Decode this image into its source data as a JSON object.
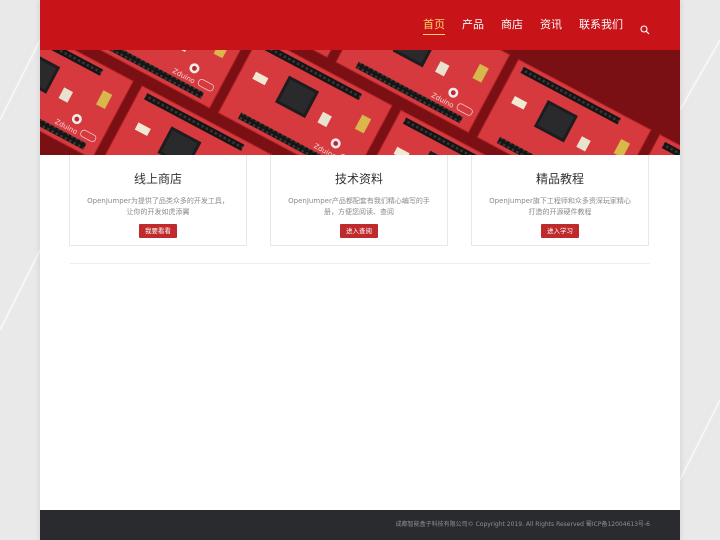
{
  "nav": {
    "items": [
      {
        "label": "首页",
        "active": true
      },
      {
        "label": "产品"
      },
      {
        "label": "商店"
      },
      {
        "label": "资讯"
      },
      {
        "label": "联系我们"
      }
    ],
    "search_icon": "search-icon"
  },
  "banner": {
    "board_label": "Zduino MEGA"
  },
  "cards": [
    {
      "title": "线上商店",
      "desc": "OpenJumper为提供了品类众多的开发工具，让你的开发如虎添翼",
      "button": "我要看看"
    },
    {
      "title": "技术资料",
      "desc": "OpenJumper产品都配套有我们精心编写的手册，方便您阅读、查阅",
      "button": "进入查阅"
    },
    {
      "title": "精品教程",
      "desc": "OpenJumper旗下工程师和众多资深玩家精心打造的开源硬件教程",
      "button": "进入学习"
    }
  ],
  "footer": {
    "text": "成都智能盒子科技有限公司© Copyright 2019. All Rights Reserved 蜀ICP备12004613号-6"
  },
  "colors": {
    "header": "#c81418",
    "nav_active": "#ffd36a",
    "button": "#bf2a2c",
    "footer": "#2a2b2e"
  }
}
